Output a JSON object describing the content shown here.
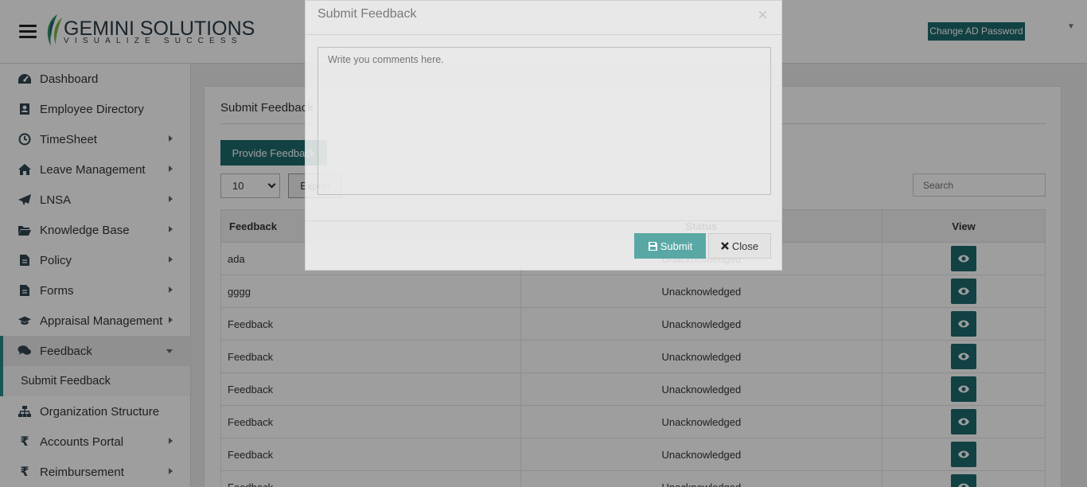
{
  "header": {
    "brand": "GEMINI SOLUTIONS",
    "tagline": "VISUALIZE SUCCESS",
    "change_password": "Change AD Password"
  },
  "sidebar": {
    "items": [
      {
        "label": "Dashboard",
        "icon": "dashboard-icon",
        "has_arrow": false
      },
      {
        "label": "Employee Directory",
        "icon": "address-book-icon",
        "has_arrow": false
      },
      {
        "label": "TimeSheet",
        "icon": "clock-icon",
        "has_arrow": true
      },
      {
        "label": "Leave Management",
        "icon": "home-icon",
        "has_arrow": true
      },
      {
        "label": "LNSA",
        "icon": "paper-plane-icon",
        "has_arrow": true
      },
      {
        "label": "Knowledge Base",
        "icon": "folder-open-icon",
        "has_arrow": true
      },
      {
        "label": "Policy",
        "icon": "document-icon",
        "has_arrow": true
      },
      {
        "label": "Forms",
        "icon": "document-icon",
        "has_arrow": true
      },
      {
        "label": "Appraisal Management",
        "icon": "graduation-cap-icon",
        "has_arrow": true
      },
      {
        "label": "Feedback",
        "icon": "comments-icon",
        "has_arrow": true,
        "active": true
      },
      {
        "label": "Submit Feedback",
        "submenu": true
      },
      {
        "label": "Organization Structure",
        "icon": "sitemap-icon",
        "has_arrow": false
      },
      {
        "label": "Accounts Portal",
        "icon": "rupee-icon",
        "has_arrow": true
      },
      {
        "label": "Reimbursement",
        "icon": "rupee-icon",
        "has_arrow": true
      }
    ]
  },
  "main": {
    "title": "Submit Feedback",
    "provide_button": "Provide Feedback",
    "page_length": "10",
    "export_label": "Export",
    "search_placeholder": "Search",
    "columns": [
      "Feedback",
      "Status",
      "View"
    ],
    "rows": [
      {
        "feedback": "ada",
        "status": "Unacknowledged"
      },
      {
        "feedback": "gggg",
        "status": "Unacknowledged"
      },
      {
        "feedback": "Feedback",
        "status": "Unacknowledged"
      },
      {
        "feedback": "Feedback",
        "status": "Unacknowledged"
      },
      {
        "feedback": "Feedback",
        "status": "Unacknowledged"
      },
      {
        "feedback": "Feedback",
        "status": "Unacknowledged"
      },
      {
        "feedback": "Feedback",
        "status": "Unacknowledged"
      },
      {
        "feedback": "Feedback",
        "status": "Unacknowledged"
      }
    ]
  },
  "modal": {
    "title": "Submit Feedback",
    "close_symbol": "×",
    "placeholder": "Write you comments here.",
    "submit_label": "Submit",
    "close_label": "Close"
  },
  "colors": {
    "accent": "#1d6a6d",
    "accent_light": "#5aa8a6"
  }
}
